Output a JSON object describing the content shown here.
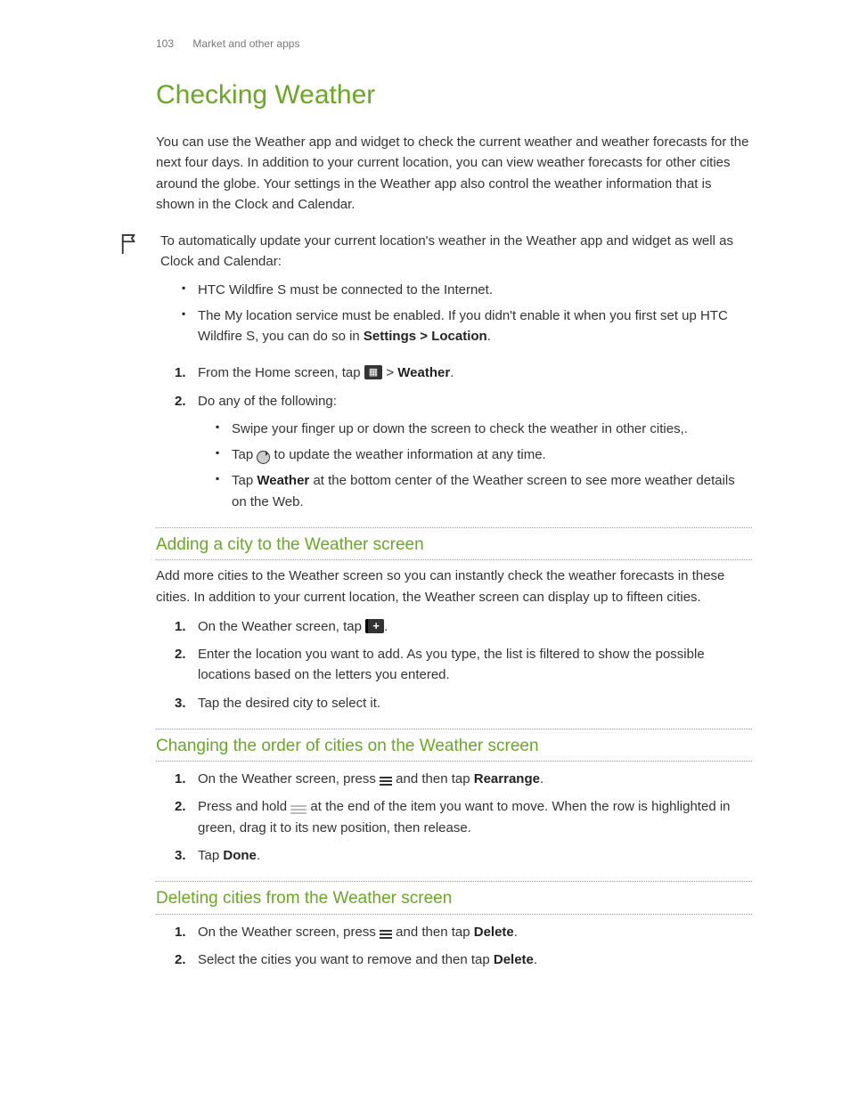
{
  "header": {
    "page_number": "103",
    "section": "Market and other apps"
  },
  "title": "Checking Weather",
  "intro": "You can use the Weather app and widget to check the current weather and weather forecasts for the next four days. In addition to your current location, you can view weather forecasts for other cities around the globe. Your settings in the Weather app also control the weather information that is shown in the Clock and Calendar.",
  "flag_block": {
    "intro": "To automatically update your current location's weather in the Weather app and widget as well as Clock and Calendar:",
    "bullets": [
      "HTC Wildfire S must be connected to the Internet.",
      "The My location service must be enabled. If you didn't enable it when you first set up HTC Wildfire S, you can do so in "
    ],
    "bullet2_bold": "Settings > Location",
    "bullet2_tail": "."
  },
  "main_steps": {
    "s1_a": "From the Home screen, tap ",
    "s1_b": " > ",
    "s1_bold": "Weather",
    "s1_c": ".",
    "s2": "Do any of the following:",
    "s2_subs": {
      "a": "Swipe your finger up or down the screen to check the weather in other cities,.",
      "b_a": "Tap ",
      "b_b": " to update the weather information at any time.",
      "c_a": "Tap ",
      "c_bold": "Weather",
      "c_b": " at the bottom center of the Weather screen to see more weather details on the Web."
    }
  },
  "sec_add": {
    "heading": "Adding a city to the Weather screen",
    "intro": "Add more cities to the Weather screen so you can instantly check the weather forecasts in these cities. In addition to your current location, the Weather screen can display up to fifteen cities.",
    "s1_a": "On the Weather screen, tap ",
    "s1_b": ".",
    "s2": "Enter the location you want to add. As you type, the list is filtered to show the possible locations based on the letters you entered.",
    "s3": "Tap the desired city to select it."
  },
  "sec_order": {
    "heading": "Changing the order of cities on the Weather screen",
    "s1_a": "On the Weather screen, press ",
    "s1_b": " and then tap ",
    "s1_bold": "Rearrange",
    "s1_c": ".",
    "s2_a": "Press and hold ",
    "s2_b": " at the end of the item you want to move. When the row is highlighted in green, drag it to its new position, then release.",
    "s3_a": "Tap ",
    "s3_bold": "Done",
    "s3_b": "."
  },
  "sec_delete": {
    "heading": "Deleting cities from the Weather screen",
    "s1_a": "On the Weather screen, press ",
    "s1_b": " and then tap ",
    "s1_bold": "Delete",
    "s1_c": ".",
    "s2_a": "Select the cities you want to remove and then tap ",
    "s2_bold": "Delete",
    "s2_b": "."
  }
}
